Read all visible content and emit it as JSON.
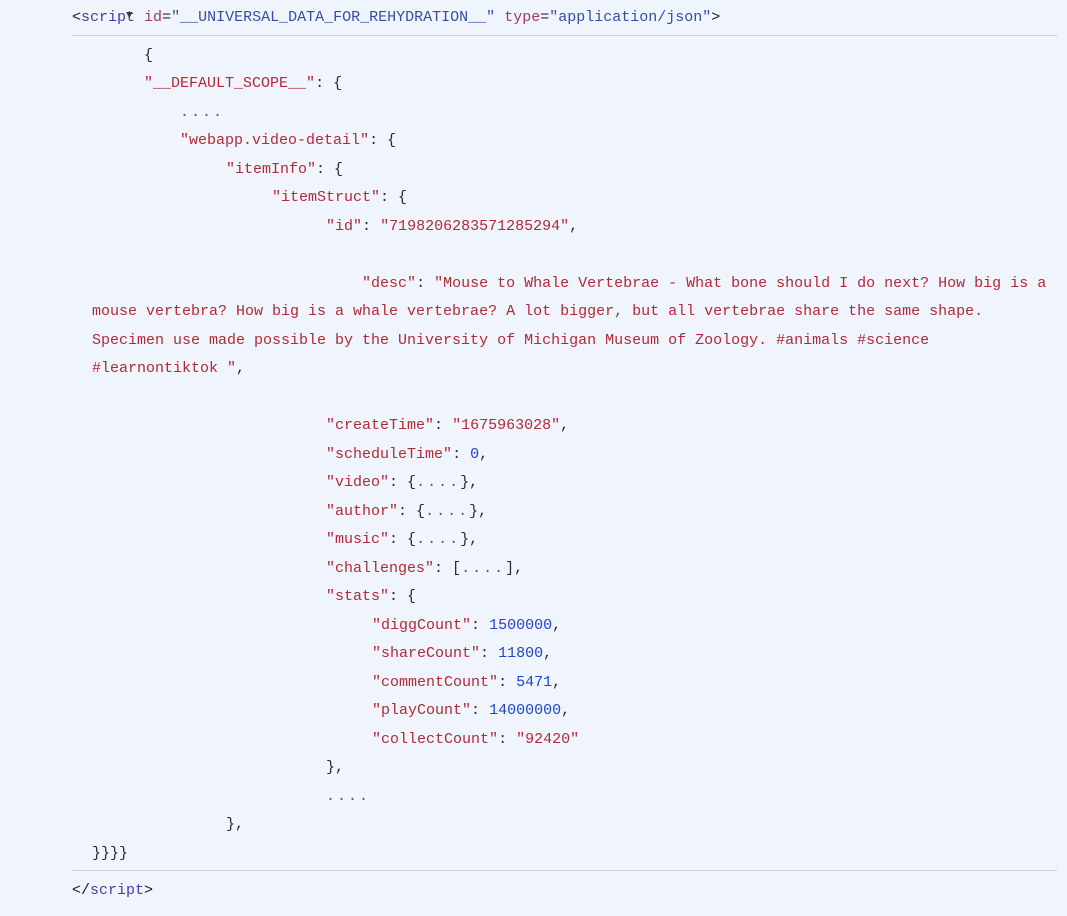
{
  "devtools": {
    "toggle_glyph": "▼",
    "script_tag": "script",
    "attr_id_name": "id",
    "attr_id_value": "__UNIVERSAL_DATA_FOR_REHYDRATION__",
    "attr_type_name": "type",
    "attr_type_value": "application/json",
    "ellipsis": "...."
  },
  "json": {
    "default_scope_key": "__DEFAULT_SCOPE__",
    "video_detail_key": "webapp.video-detail",
    "itemInfo_key": "itemInfo",
    "itemStruct_key": "itemStruct",
    "id_key": "id",
    "id_value": "7198206283571285294",
    "desc_key": "desc",
    "desc_value": "Mouse to Whale Vertebrae - What bone should I do next? How big is a mouse vertebra? How big is a whale vertebrae? A lot bigger, but all vertebrae share the same shape. Specimen use made possible by the University of Michigan Museum of Zoology. #animals #science #learnontiktok ",
    "createTime_key": "createTime",
    "createTime_value": "1675963028",
    "scheduleTime_key": "scheduleTime",
    "scheduleTime_value": "0",
    "video_key": "video",
    "author_key": "author",
    "music_key": "music",
    "challenges_key": "challenges",
    "stats_key": "stats",
    "diggCount_key": "diggCount",
    "diggCount_value": "1500000",
    "shareCount_key": "shareCount",
    "shareCount_value": "11800",
    "commentCount_key": "commentCount",
    "commentCount_value": "5471",
    "playCount_key": "playCount",
    "playCount_value": "14000000",
    "collectCount_key": "collectCount",
    "collectCount_value": "92420",
    "close_braces": "}}}}"
  }
}
